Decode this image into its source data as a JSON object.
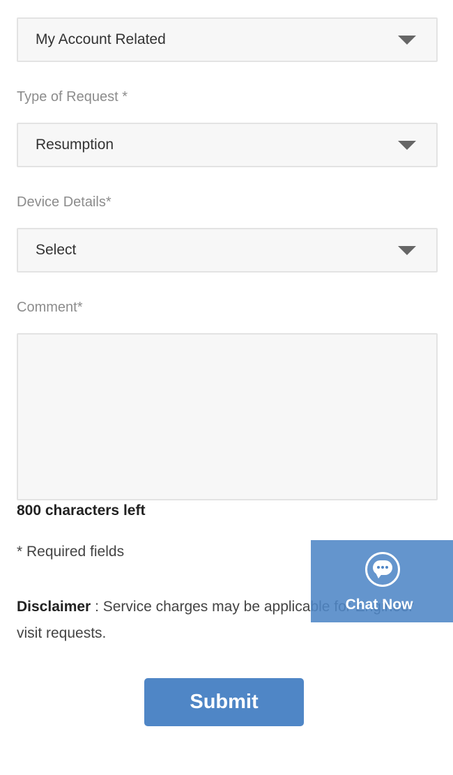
{
  "form": {
    "category_select": {
      "value": "My Account Related"
    },
    "request_type": {
      "label": "Type of Request *",
      "value": "Resumption"
    },
    "device_details": {
      "label": "Device Details*",
      "value": "Select"
    },
    "comment": {
      "label": "Comment*",
      "value": "",
      "chars_left": "800 characters left"
    },
    "required_note": "* Required fields",
    "disclaimer": {
      "label": "Disclaimer",
      "text": " : Service charges may be applicable for Engineer visit requests."
    },
    "submit_label": "Submit"
  },
  "chat_widget": {
    "label": "Chat Now",
    "icon": "chat-bubble-icon"
  },
  "colors": {
    "accent": "#4f86c6",
    "field_bg": "#f7f7f7",
    "field_border": "#e3e3e3",
    "label": "#8c8c8c"
  }
}
